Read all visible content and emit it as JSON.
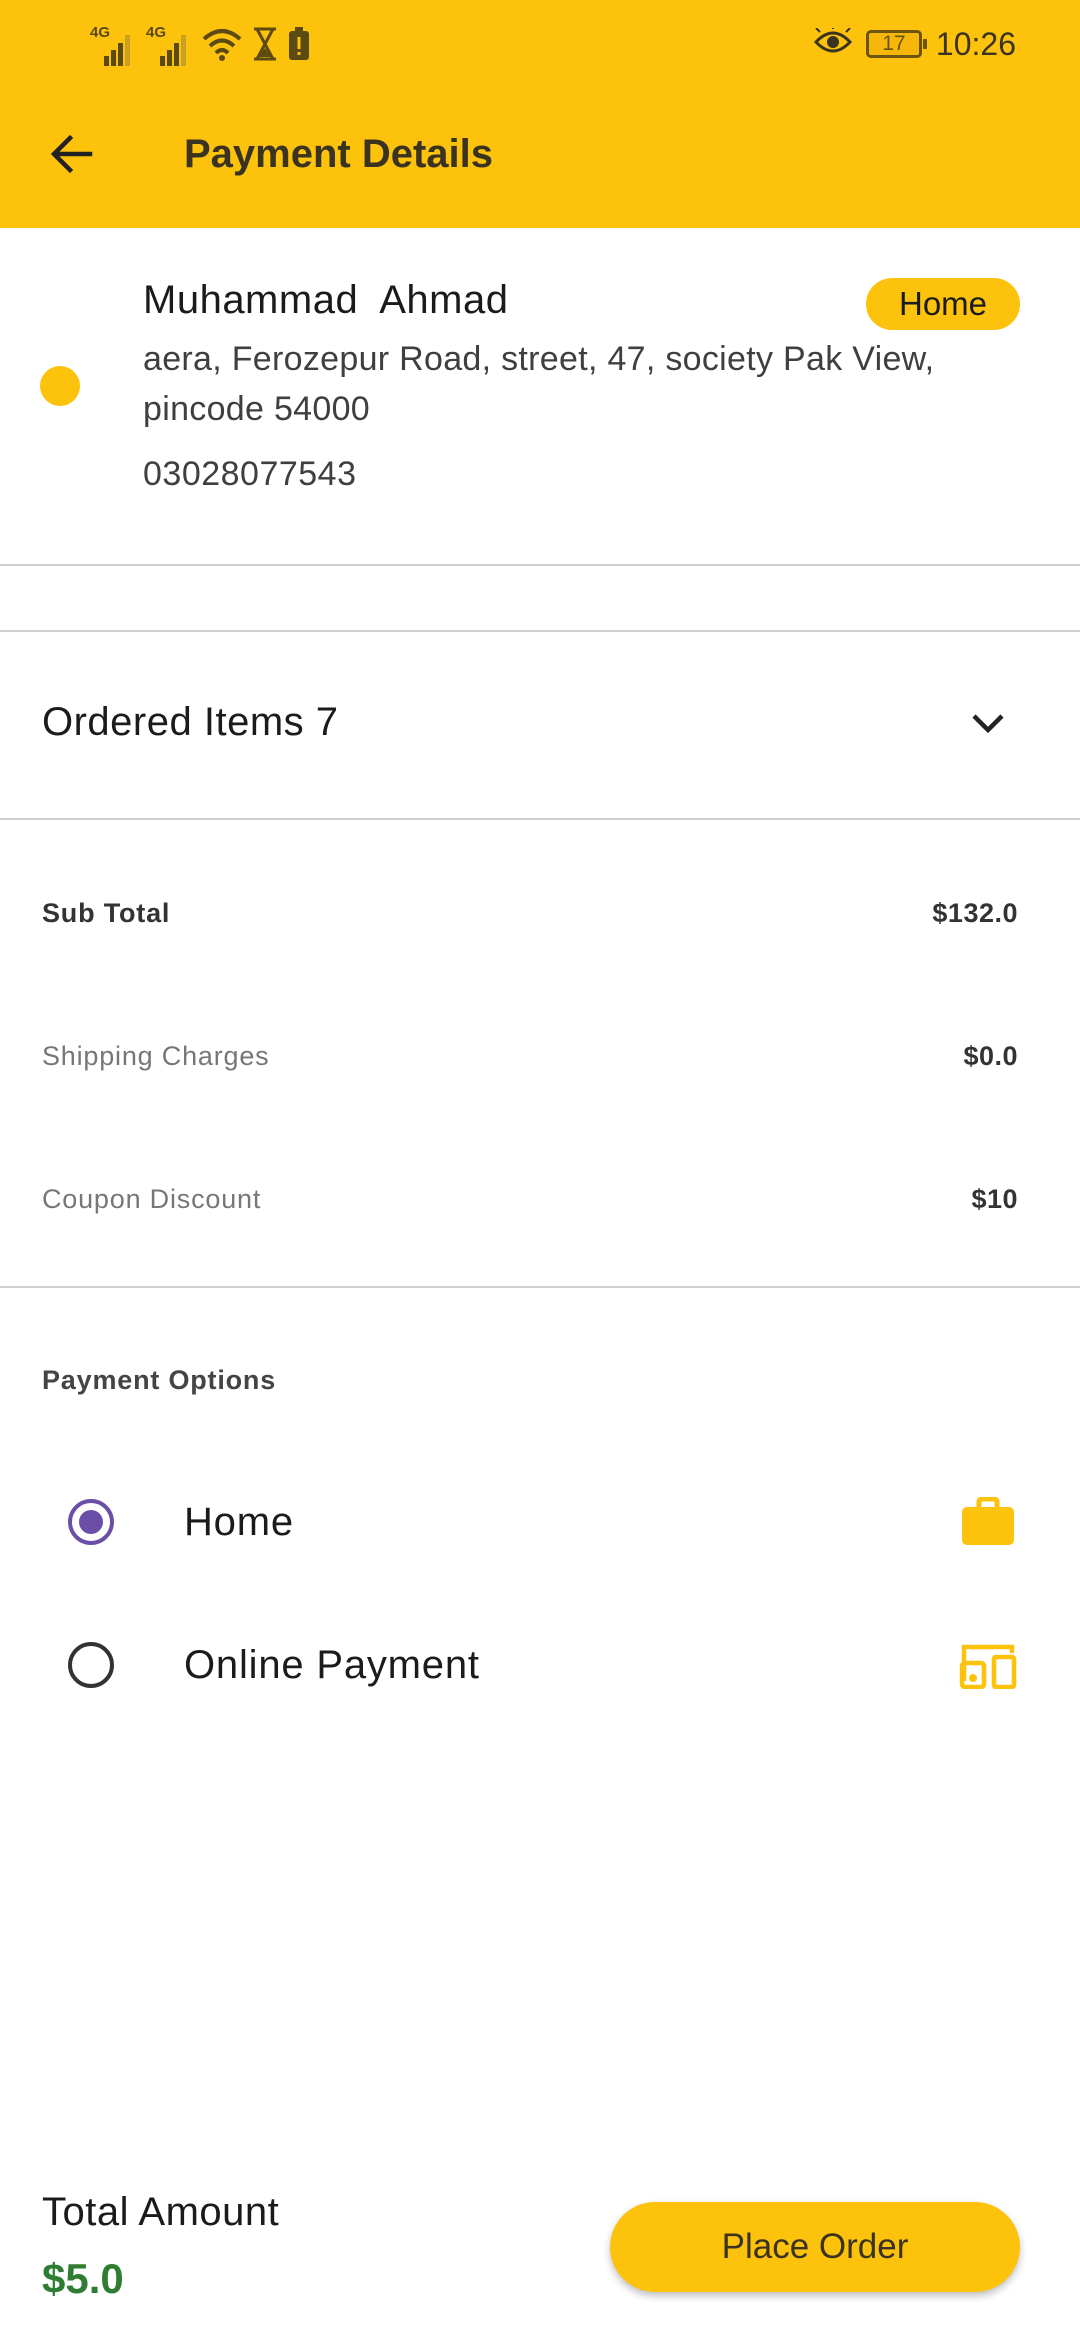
{
  "status_bar": {
    "network_1": "4G",
    "network_2": "4G",
    "battery_level": "17",
    "time": "10:26"
  },
  "header": {
    "title": "Payment Details",
    "back_icon": "arrow-left-icon"
  },
  "address": {
    "name": "Muhammad  Ahmad",
    "tag": "Home",
    "line1": "aera, Ferozepur Road, street, 47, society Pak View,",
    "line2": "pincode 54000",
    "phone": "03028077543"
  },
  "ordered_items": {
    "label": "Ordered Items 7",
    "expand_icon": "chevron-down-icon"
  },
  "summary": {
    "sub_total_label": "Sub Total",
    "sub_total_value": "$132.0",
    "shipping_label": "Shipping Charges",
    "shipping_value": "$0.0",
    "coupon_label": "Coupon Discount",
    "coupon_value": "$10"
  },
  "payment": {
    "title": "Payment Options",
    "options": [
      {
        "label": "Home",
        "selected": true,
        "icon": "briefcase-icon"
      },
      {
        "label": "Online Payment",
        "selected": false,
        "icon": "devices-icon"
      }
    ]
  },
  "footer": {
    "total_label": "Total Amount",
    "total_value": "$5.0",
    "place_order_label": "Place Order"
  },
  "colors": {
    "accent": "#FDC20C",
    "radio_selected": "#6A4EA8",
    "total_green": "#2E7D32"
  }
}
